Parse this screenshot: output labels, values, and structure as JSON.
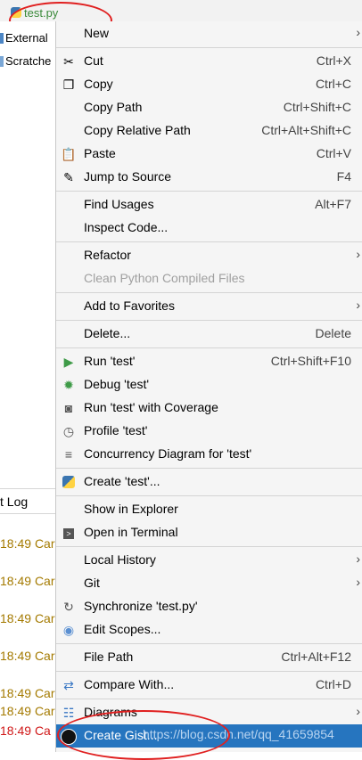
{
  "file_tab": {
    "name": "test.py"
  },
  "left_panel": {
    "items": [
      {
        "label": "External"
      },
      {
        "label": "Scratche"
      }
    ],
    "event_log_title": "t Log",
    "event_rows": [
      {
        "time": "18:49",
        "text": "Car",
        "color": "#a47a00"
      },
      {
        "time": "18:49",
        "text": "Car",
        "color": "#a47a00"
      },
      {
        "time": "18:49",
        "text": "Car",
        "color": "#a47a00"
      },
      {
        "time": "18:49",
        "text": "Car",
        "color": "#a47a00"
      },
      {
        "time": "18:49",
        "text": "Car",
        "color": "#a47a00"
      },
      {
        "time": "18:49",
        "text": "Car",
        "color": "#a47a00"
      },
      {
        "time": "18:49",
        "text": "Ca",
        "color": "#d01818"
      }
    ]
  },
  "menu": {
    "new": "New",
    "cut": {
      "label": "Cut",
      "shortcut": "Ctrl+X"
    },
    "copy": {
      "label": "Copy",
      "shortcut": "Ctrl+C"
    },
    "copy_path": {
      "label": "Copy Path",
      "shortcut": "Ctrl+Shift+C"
    },
    "copy_relative_path": {
      "label": "Copy Relative Path",
      "shortcut": "Ctrl+Alt+Shift+C"
    },
    "paste": {
      "label": "Paste",
      "shortcut": "Ctrl+V"
    },
    "jump_to_source": {
      "label": "Jump to Source",
      "shortcut": "F4"
    },
    "find_usages": {
      "label": "Find Usages",
      "shortcut": "Alt+F7"
    },
    "inspect_code": "Inspect Code...",
    "refactor": "Refactor",
    "clean_python": "Clean Python Compiled Files",
    "add_to_favorites": "Add to Favorites",
    "delete": {
      "label": "Delete...",
      "shortcut": "Delete"
    },
    "run": {
      "label": "Run 'test'",
      "shortcut": "Ctrl+Shift+F10"
    },
    "debug": "Debug 'test'",
    "run_coverage": "Run 'test' with Coverage",
    "profile": "Profile 'test'",
    "concurrency": "Concurrency Diagram for 'test'",
    "create_test": "Create 'test'...",
    "show_in_explorer": "Show in Explorer",
    "open_in_terminal": "Open in Terminal",
    "local_history": "Local History",
    "git": "Git",
    "synchronize": "Synchronize 'test.py'",
    "edit_scopes": "Edit Scopes...",
    "file_path": {
      "label": "File Path",
      "shortcut": "Ctrl+Alt+F12"
    },
    "compare_with": {
      "label": "Compare With...",
      "shortcut": "Ctrl+D"
    },
    "diagrams": "Diagrams",
    "create_gist": "Create Gist..."
  },
  "watermark": "https://blog.csdn.net/qq_41659854",
  "colors": {
    "highlight": "#2675bf",
    "annotation": "#e02020",
    "menu_bg": "#f5f5f5"
  }
}
